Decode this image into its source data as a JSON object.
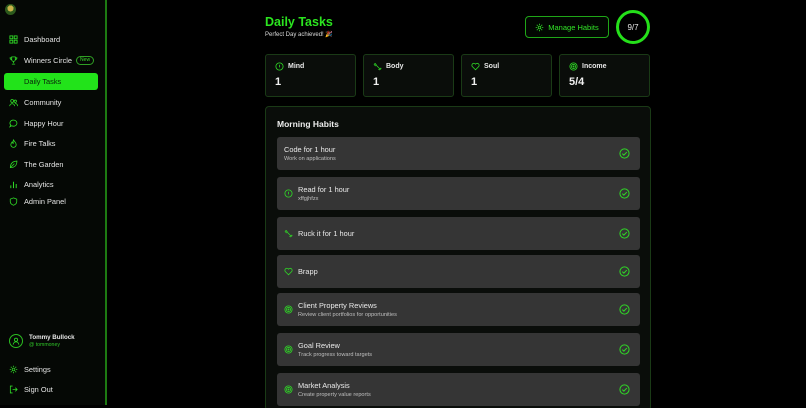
{
  "sidebar": {
    "items": [
      {
        "label": "Dashboard",
        "icon": "dashboard-icon"
      },
      {
        "label": "Winners Circle",
        "icon": "trophy-icon",
        "badge": "New"
      },
      {
        "label": "Daily Tasks",
        "icon": "none",
        "active": true
      },
      {
        "label": "Community",
        "icon": "users-icon"
      },
      {
        "label": "Happy Hour",
        "icon": "chat-bubble-icon"
      },
      {
        "label": "Fire Talks",
        "icon": "flame-icon"
      },
      {
        "label": "The Garden",
        "icon": "leaf-icon"
      },
      {
        "label": "Analytics",
        "icon": "bar-chart-icon"
      },
      {
        "label": "Admin Panel",
        "icon": "shield-icon"
      }
    ],
    "user": {
      "name": "Tommy Bullock",
      "handle": "@ tommoney"
    },
    "footer": [
      {
        "label": "Settings",
        "icon": "gear-icon"
      },
      {
        "label": "Sign Out",
        "icon": "sign-out-icon"
      }
    ]
  },
  "header": {
    "title": "Daily Tasks",
    "subtitle": "Perfect Day achieved! 🎉",
    "manage_label": "Manage Habits",
    "counter": "9/7"
  },
  "stats": [
    {
      "label": "Mind",
      "value": "1",
      "icon": "circle-info-icon"
    },
    {
      "label": "Body",
      "value": "1",
      "icon": "dumbbell-icon"
    },
    {
      "label": "Soul",
      "value": "1",
      "icon": "heart-icon"
    },
    {
      "label": "Income",
      "value": "5/4",
      "icon": "target-icon"
    }
  ],
  "morning": {
    "title": "Morning Habits",
    "habits": [
      {
        "title": "Code for 1 hour",
        "subtitle": "Work on applications",
        "icon": "none",
        "done": true
      },
      {
        "title": "Read for 1 hour",
        "subtitle": "xffgjhfzx",
        "icon": "circle-info-icon",
        "done": true
      },
      {
        "title": "Ruck it for 1 hour",
        "subtitle": "",
        "icon": "dumbbell-icon",
        "done": true
      },
      {
        "title": "Brapp",
        "subtitle": "",
        "icon": "heart-icon",
        "done": true
      },
      {
        "title": "Client Property Reviews",
        "subtitle": "Review client portfolios for opportunities",
        "icon": "target-icon",
        "done": true
      },
      {
        "title": "Goal Review",
        "subtitle": "Track progress toward targets",
        "icon": "target-icon",
        "done": true
      },
      {
        "title": "Market Analysis",
        "subtitle": "Create property value reports",
        "icon": "target-icon",
        "done": true
      }
    ]
  },
  "colors": {
    "accent": "#22e31a",
    "card": "#353535",
    "background": "#000000"
  }
}
